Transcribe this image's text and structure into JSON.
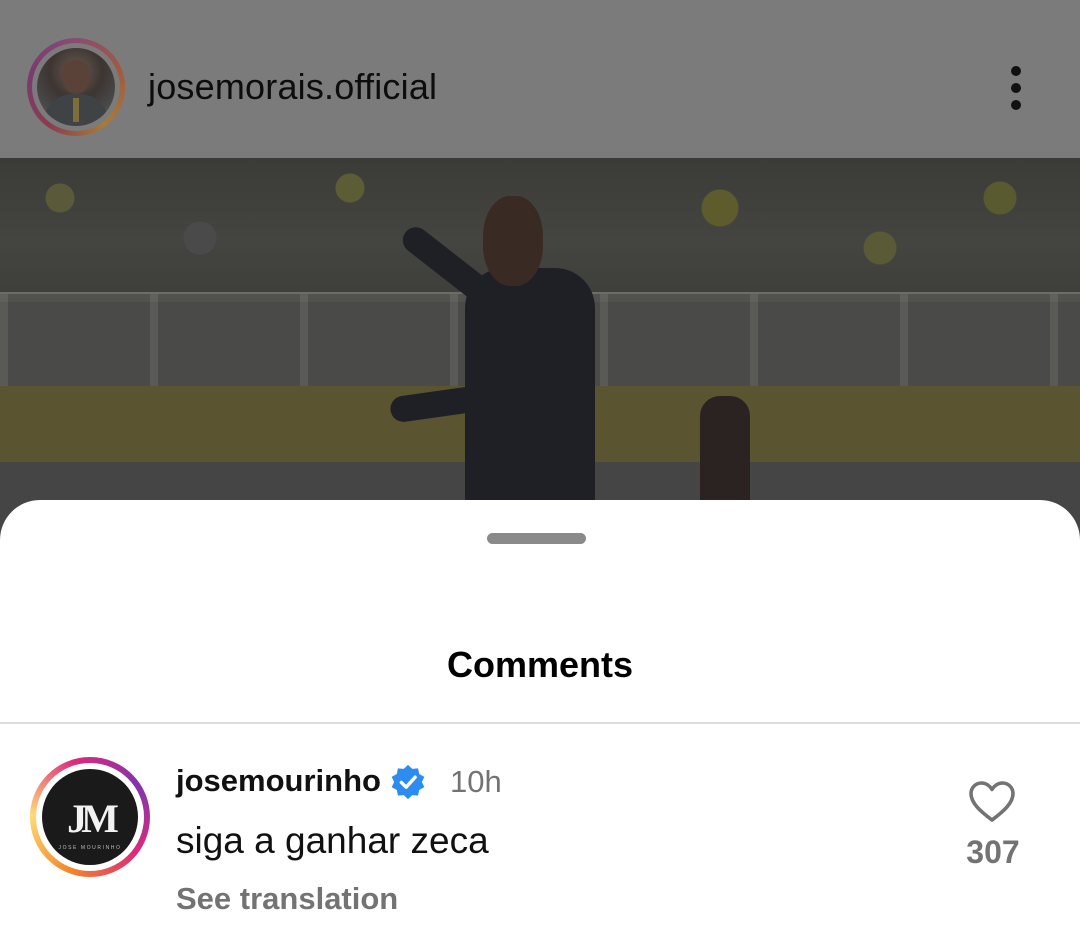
{
  "post": {
    "username": "josemorais.official"
  },
  "comments_sheet": {
    "title": "Comments",
    "comments": [
      {
        "username": "josemourinho",
        "verified": true,
        "time": "10h",
        "text": "siga a ganhar zeca",
        "see_translation": "See translation",
        "likes": "307",
        "avatar_logo_text": "JM",
        "avatar_logo_subtext": "JOSE MOURINHO"
      }
    ]
  },
  "colors": {
    "verified_badge": "#2d8cf0",
    "muted_text": "#737373"
  },
  "icons": {
    "more": "more-vertical-icon",
    "heart": "heart-outline-icon",
    "verified": "verified-badge-icon"
  }
}
